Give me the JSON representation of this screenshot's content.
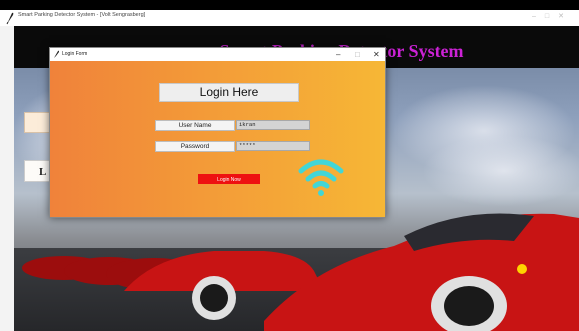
{
  "main_window": {
    "title": "Smart Parking Detector System - [Volt Sengrasberg]",
    "header_title": "Smart Parking Detector System",
    "side_button_text": "L"
  },
  "login_window": {
    "title": "Login Form",
    "controls": {
      "minimize": "–",
      "maximize": "□",
      "close": "✕"
    },
    "heading": "Login Here",
    "username_label": "User Name",
    "username_value": "ikran",
    "password_label": "Password",
    "password_value": "*****",
    "login_button": "Login Now"
  },
  "icons": [
    "app-feather-icon",
    "login-feather-icon",
    "wifi-icon"
  ],
  "colors": {
    "header_title": "#cc22d6",
    "login_gradient_start": "#f0823a",
    "login_gradient_end": "#f6b736",
    "login_button": "#ee1111",
    "wifi_accent": "#42d6d6"
  }
}
